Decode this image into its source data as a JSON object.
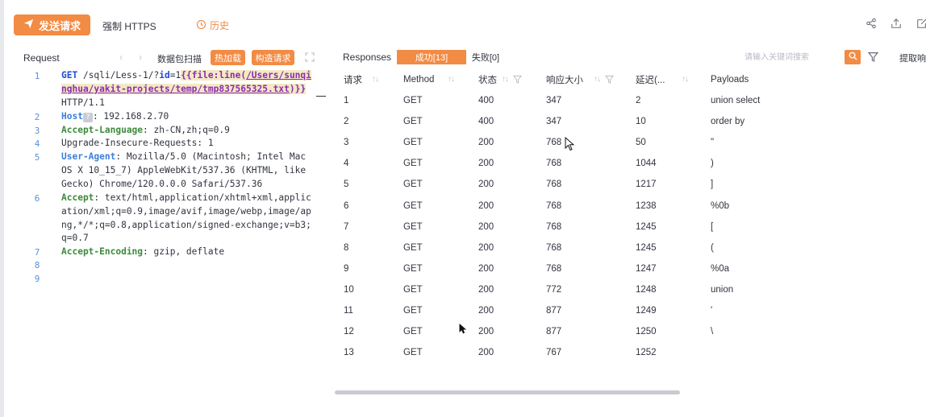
{
  "toolbar": {
    "send_label": "发送请求",
    "https_label": "强制 HTTPS",
    "history_label": "历史"
  },
  "request": {
    "title": "Request",
    "scan_label": "数据包扫描",
    "hot_load_label": "热加载",
    "construct_label": "构造请求",
    "line_numbers": [
      "1",
      "2",
      "3",
      "4",
      "5",
      "6",
      "7",
      "8",
      "9"
    ],
    "lines": {
      "l1_method": "GET",
      "l1_path": " /sqli/Less-1/?",
      "l1_param": "id",
      "l1_eq": "=1",
      "l1_tag": "{{file:line(",
      "l1_file": "/Users/sunqinghua/yakit-projects/temp/tmp837565325.txt",
      "l1_close": ")}}",
      "l1_proto": " HTTP/1.1",
      "l2_key": "Host",
      "l2_badge": "?",
      "l2_val": ": 192.168.2.70",
      "l3_key": "Accept-Language",
      "l3_val": ": zh-CN,zh;q=0.9",
      "l4_text": "Upgrade-Insecure-Requests: 1",
      "l5_key": "User-Agent",
      "l5_val": ": Mozilla/5.0 (Macintosh; Intel Mac OS X 10_15_7) AppleWebKit/537.36 (KHTML, like Gecko) Chrome/120.0.0.0 Safari/537.36",
      "l6_key": "Accept",
      "l6_val": ": text/html,application/xhtml+xml,application/xml;q=0.9,image/avif,image/webp,image/apng,*/*;q=0.8,application/signed-exchange;v=b3;q=0.7",
      "l7_key": "Accept-Encoding",
      "l7_val": ": gzip, deflate"
    }
  },
  "responses": {
    "title": "Responses",
    "tab_success": "成功[13]",
    "tab_fail": "失败[0]",
    "search_placeholder": "请输入关键词搜索",
    "extract_label": "提取响应",
    "columns": [
      "请求",
      "Method",
      "状态",
      "响应大小",
      "延迟(...",
      "Payloads"
    ],
    "rows": [
      {
        "idx": "1",
        "method": "GET",
        "status": "400",
        "size": "347",
        "delay": "2",
        "payload": "union select"
      },
      {
        "idx": "2",
        "method": "GET",
        "status": "400",
        "size": "347",
        "delay": "10",
        "payload": "order by"
      },
      {
        "idx": "3",
        "method": "GET",
        "status": "200",
        "size": "768",
        "delay": "50",
        "payload": "\""
      },
      {
        "idx": "4",
        "method": "GET",
        "status": "200",
        "size": "768",
        "delay": "1044",
        "payload": ")"
      },
      {
        "idx": "5",
        "method": "GET",
        "status": "200",
        "size": "768",
        "delay": "1217",
        "payload": "]"
      },
      {
        "idx": "6",
        "method": "GET",
        "status": "200",
        "size": "768",
        "delay": "1238",
        "payload": "%0b"
      },
      {
        "idx": "7",
        "method": "GET",
        "status": "200",
        "size": "768",
        "delay": "1245",
        "payload": "["
      },
      {
        "idx": "8",
        "method": "GET",
        "status": "200",
        "size": "768",
        "delay": "1245",
        "payload": "("
      },
      {
        "idx": "9",
        "method": "GET",
        "status": "200",
        "size": "768",
        "delay": "1247",
        "payload": "%0a"
      },
      {
        "idx": "10",
        "method": "GET",
        "status": "200",
        "size": "772",
        "delay": "1248",
        "payload": "union"
      },
      {
        "idx": "11",
        "method": "GET",
        "status": "200",
        "size": "877",
        "delay": "1249",
        "payload": "'"
      },
      {
        "idx": "12",
        "method": "GET",
        "status": "200",
        "size": "877",
        "delay": "1250",
        "payload": "\\"
      },
      {
        "idx": "13",
        "method": "GET",
        "status": "200",
        "size": "767",
        "delay": "1252",
        "payload": ""
      }
    ]
  },
  "colors": {
    "accent": "#f28b44",
    "status_error": "#d94a4a",
    "status_ok": "#8fd39d",
    "delay_fast": "#6fc7b7",
    "delay_slow": "#d9534f"
  },
  "icons": [
    "send-icon",
    "history-icon",
    "share-icon",
    "upload-icon",
    "edit-icon",
    "chevron-left-icon",
    "chevron-right-icon",
    "expand-icon",
    "search-icon",
    "filter-icon",
    "sort-icon",
    "funnel-icon",
    "mouse-cursor-icon"
  ]
}
